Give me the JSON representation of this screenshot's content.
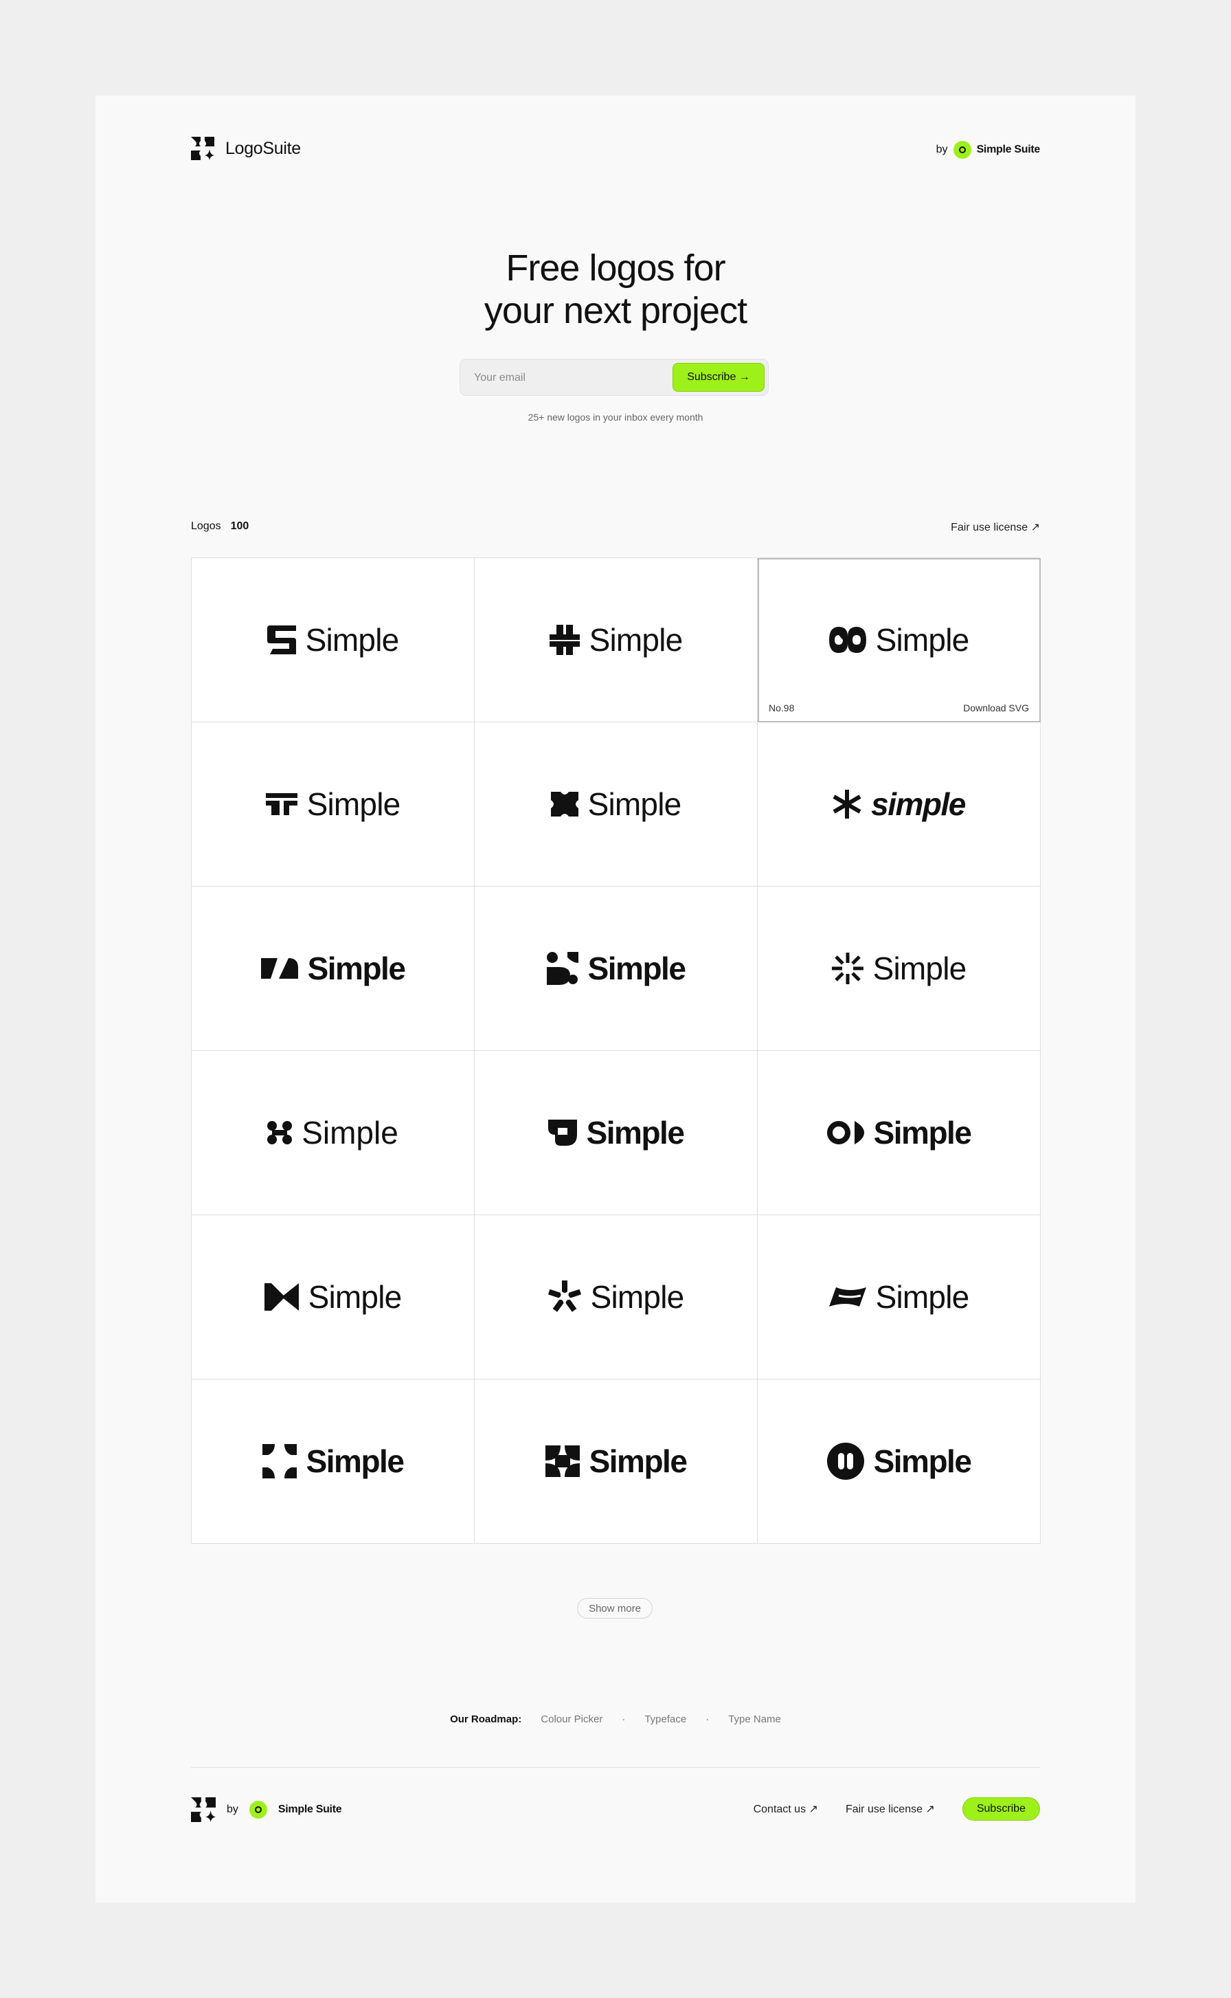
{
  "header": {
    "brand_name": "LogoSuite",
    "by_label": "by",
    "partner_name": "Simple Suite"
  },
  "hero": {
    "title_line1": "Free logos for",
    "title_line2": "your next project",
    "email_placeholder": "Your email",
    "subscribe_label": "Subscribe →",
    "note": "25+ new logos in your inbox every month"
  },
  "gallery": {
    "label": "Logos",
    "count": "100",
    "license_link": "Fair use license ↗",
    "selected": {
      "number": "No.98",
      "download": "Download SVG"
    },
    "logos": [
      {
        "mark": "s-square-icon",
        "word": "Simple"
      },
      {
        "mark": "hash-cross-icon",
        "word": "Simple"
      },
      {
        "mark": "infinity-loop-icon",
        "word": "Simple"
      },
      {
        "mark": "t-steps-icon",
        "word": "Simple"
      },
      {
        "mark": "x-cross-block-icon",
        "word": "Simple"
      },
      {
        "mark": "asterisk-icon",
        "word": "simple"
      },
      {
        "mark": "slant-blocks-icon",
        "word": "Simple"
      },
      {
        "mark": "dots-shapes-icon",
        "word": "Simple"
      },
      {
        "mark": "burst-lines-icon",
        "word": "Simple"
      },
      {
        "mark": "four-dots-icon",
        "word": "Simple"
      },
      {
        "mark": "j-hook-icon",
        "word": "Simple"
      },
      {
        "mark": "ring-quote-icon",
        "word": "Simple"
      },
      {
        "mark": "bowtie-n-icon",
        "word": "Simple"
      },
      {
        "mark": "pinwheel-icon",
        "word": "Simple"
      },
      {
        "mark": "wave-flag-icon",
        "word": "Simple"
      },
      {
        "mark": "corners-square-icon",
        "word": "Simple"
      },
      {
        "mark": "petals-square-icon",
        "word": "Simple"
      },
      {
        "mark": "pause-circle-icon",
        "word": "Simple"
      }
    ]
  },
  "show_more_label": "Show more",
  "roadmap": {
    "label": "Our Roadmap:",
    "items": [
      "Colour Picker",
      "Typeface",
      "Type Name"
    ]
  },
  "footer": {
    "by_label": "by",
    "partner_name": "Simple Suite",
    "contact_link": "Contact us ↗",
    "license_link": "Fair use license ↗",
    "subscribe_label": "Subscribe"
  },
  "colors": {
    "accent": "#9ef01a",
    "page_bg": "#f9f9f9",
    "outer_bg": "#efefef"
  }
}
